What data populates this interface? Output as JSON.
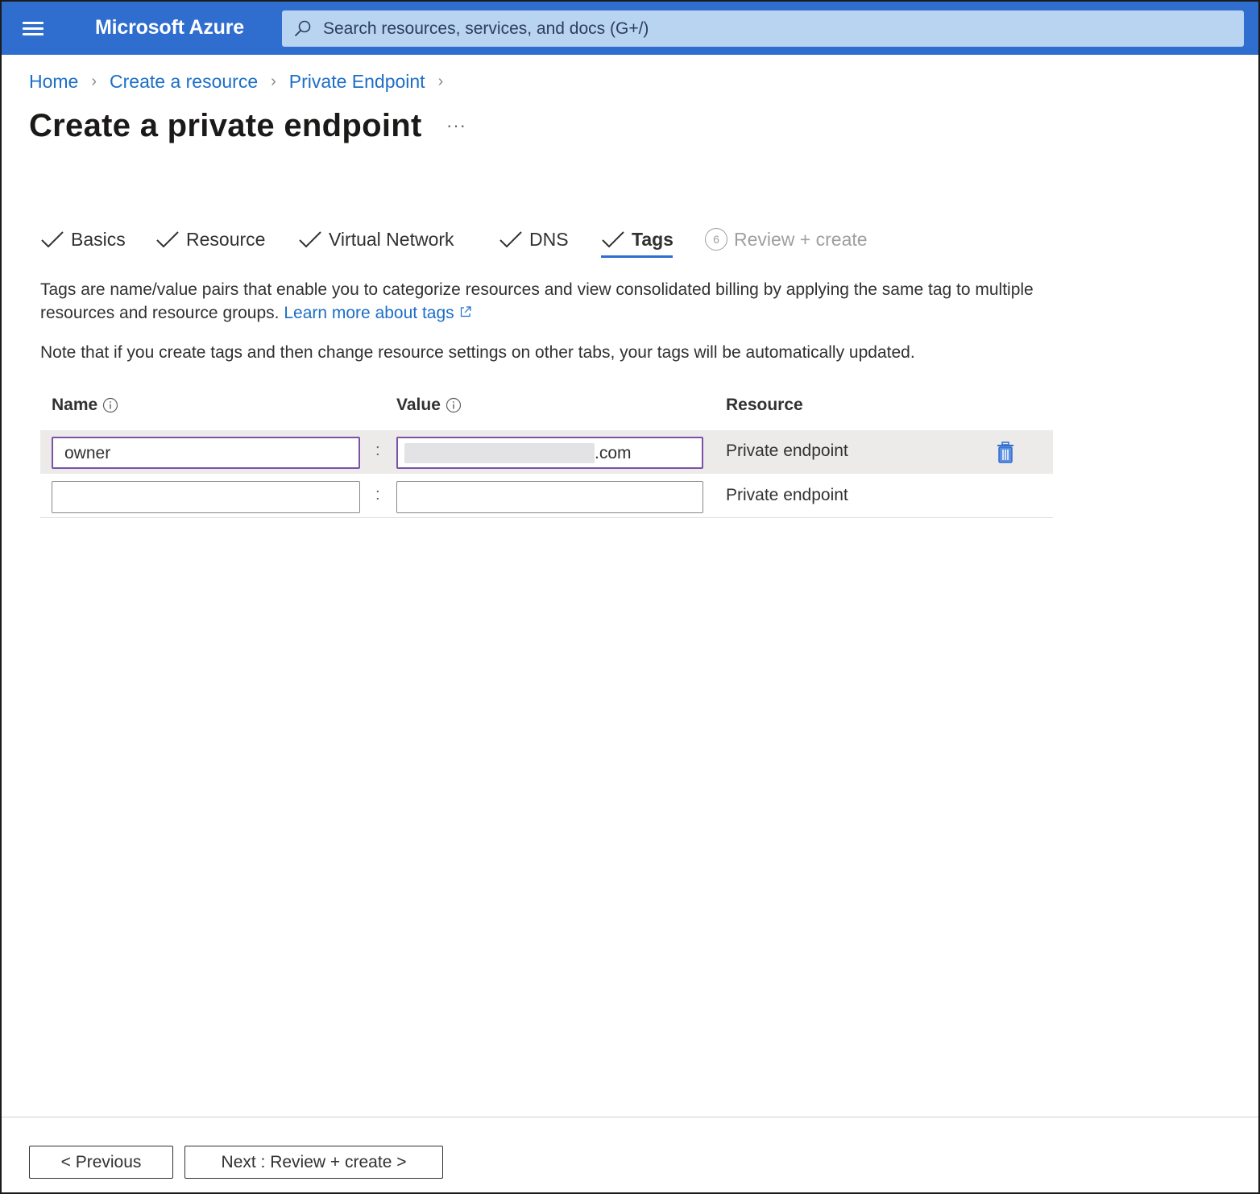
{
  "header": {
    "brand": "Microsoft Azure",
    "search_placeholder": "Search resources, services, and docs (G+/)",
    "color": "#2f6dcf"
  },
  "breadcrumb": [
    "Home",
    "Create a resource",
    "Private Endpoint"
  ],
  "page": {
    "title": "Create a private endpoint",
    "more": "···"
  },
  "tabs": [
    {
      "label": "Basics",
      "state": "completed"
    },
    {
      "label": "Resource",
      "state": "completed"
    },
    {
      "label": "Virtual Network",
      "state": "completed"
    },
    {
      "label": "DNS",
      "state": "completed"
    },
    {
      "label": "Tags",
      "state": "active"
    },
    {
      "label": "Review + create",
      "state": "disabled",
      "step": "6"
    }
  ],
  "description": {
    "text": "Tags are name/value pairs that enable you to categorize resources and view consolidated billing by applying the same tag to multiple resources and resource groups.",
    "link": "Learn more about tags",
    "note": "Note that if you create tags and then change resource settings on other tabs, your tags will be automatically updated."
  },
  "tags_table": {
    "headers": {
      "name": "Name",
      "value": "Value",
      "resource": "Resource"
    },
    "separator": ":",
    "rows": [
      {
        "name": "owner",
        "value": ".com",
        "resource": "Private endpoint"
      },
      {
        "name": "",
        "value": "",
        "resource": "Private endpoint"
      }
    ]
  },
  "footer": {
    "previous": "< Previous",
    "next": "Next : Review + create >"
  }
}
